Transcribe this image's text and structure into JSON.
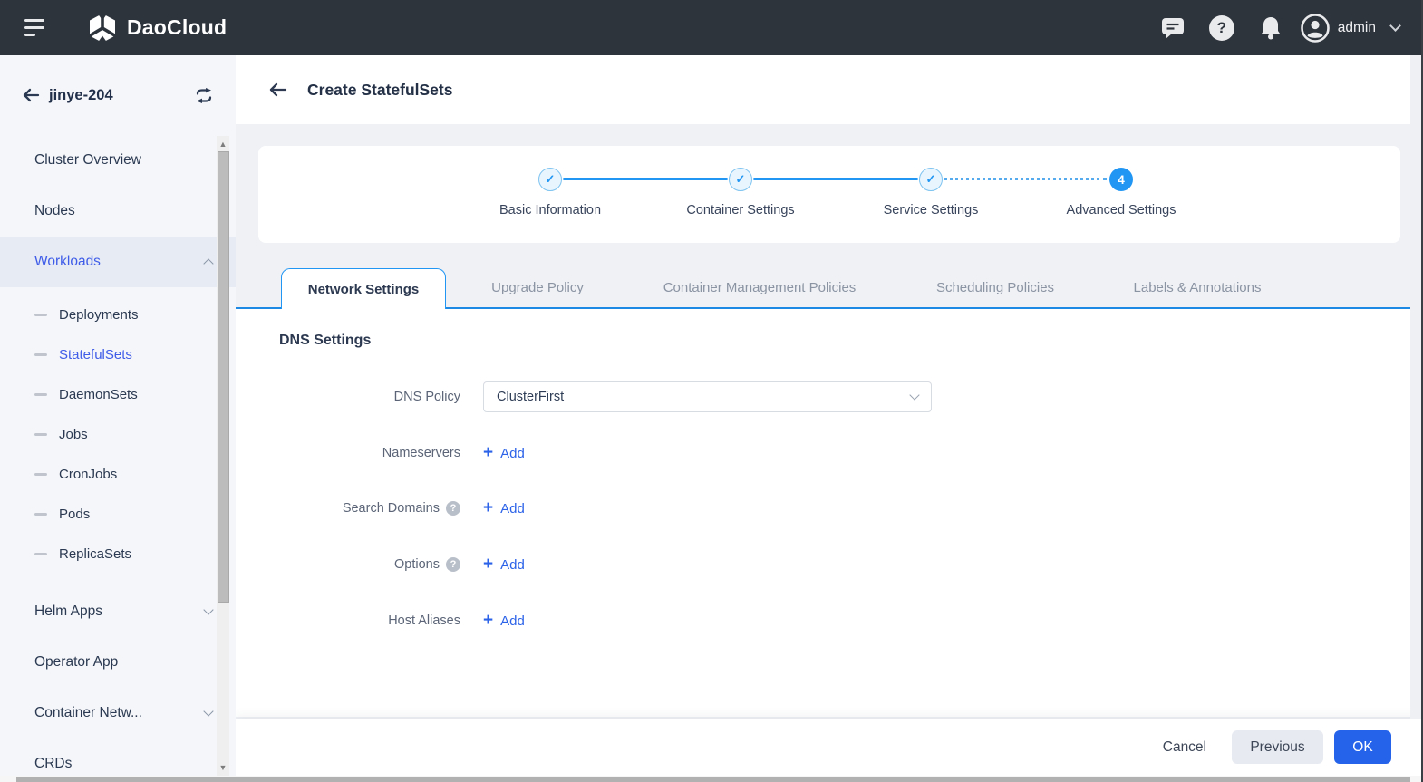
{
  "topbar": {
    "brand": "DaoCloud",
    "user": "admin",
    "accent_dark": "#2e343c"
  },
  "sidebar": {
    "cluster": "jinye-204",
    "items": [
      {
        "label": "Cluster Overview"
      },
      {
        "label": "Nodes"
      },
      {
        "label": "Workloads",
        "active": true,
        "expanded": true
      },
      {
        "label": "Deployments",
        "sub": true
      },
      {
        "label": "StatefulSets",
        "sub": true,
        "active": true
      },
      {
        "label": "DaemonSets",
        "sub": true
      },
      {
        "label": "Jobs",
        "sub": true
      },
      {
        "label": "CronJobs",
        "sub": true
      },
      {
        "label": "Pods",
        "sub": true
      },
      {
        "label": "ReplicaSets",
        "sub": true
      },
      {
        "label": "Helm Apps",
        "collapsed": true
      },
      {
        "label": "Operator App"
      },
      {
        "label": "Container Netw...",
        "collapsed": true
      },
      {
        "label": "CRDs"
      }
    ]
  },
  "page": {
    "title": "Create StatefulSets",
    "steps": [
      {
        "label": "Basic Information",
        "state": "done"
      },
      {
        "label": "Container Settings",
        "state": "done"
      },
      {
        "label": "Service Settings",
        "state": "done"
      },
      {
        "label": "Advanced Settings",
        "state": "current",
        "number": "4"
      }
    ],
    "tabs": [
      {
        "label": "Network Settings",
        "active": true
      },
      {
        "label": "Upgrade Policy"
      },
      {
        "label": "Container Management Policies"
      },
      {
        "label": "Scheduling Policies"
      },
      {
        "label": "Labels & Annotations"
      }
    ],
    "section_title": "DNS Settings",
    "form": {
      "dns_policy": {
        "label": "DNS Policy",
        "value": "ClusterFirst"
      },
      "rows": [
        {
          "label": "Nameservers",
          "help": false,
          "action": "Add"
        },
        {
          "label": "Search Domains",
          "help": true,
          "action": "Add"
        },
        {
          "label": "Options",
          "help": true,
          "action": "Add"
        },
        {
          "label": "Host Aliases",
          "help": false,
          "action": "Add"
        }
      ]
    },
    "footer": {
      "cancel": "Cancel",
      "previous": "Previous",
      "ok": "OK"
    }
  },
  "icons": {
    "check": "✓",
    "plus": "+",
    "question": "?",
    "scroll_up": "▲",
    "scroll_down": "▼"
  },
  "colors": {
    "topbar_bg": "#2e343c",
    "sidebar_bg": "#f5f6f9",
    "active_link_blue": "#3f5ce8",
    "step_blue": "#2196f3",
    "tab_line_blue": "#1e88e5",
    "add_link_blue": "#2b62e8",
    "ok_button_blue": "#2563eb",
    "page_bg": "#eff1f5"
  }
}
